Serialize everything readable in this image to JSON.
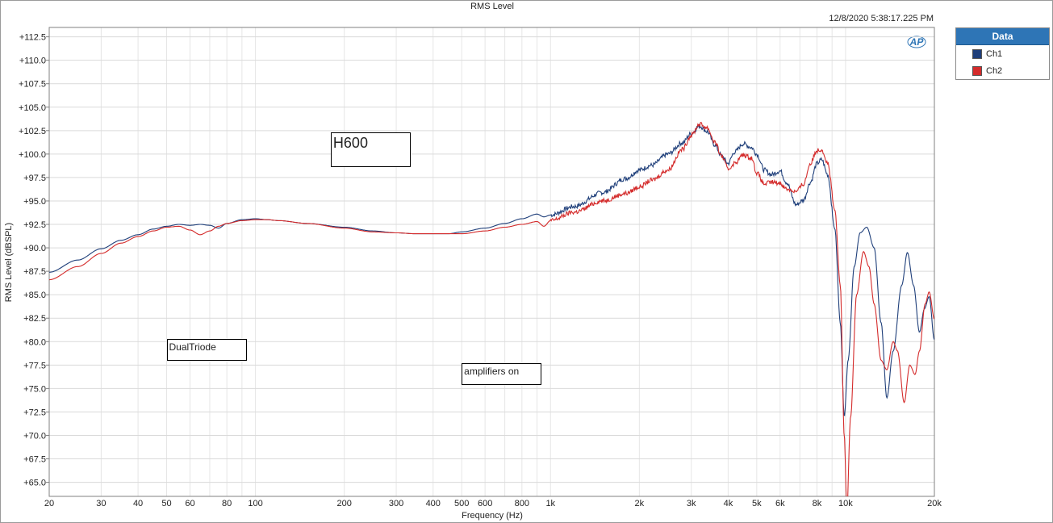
{
  "chart_data": {
    "type": "line",
    "title": "RMS Level",
    "timestamp": "12/8/2020 5:38:17.225 PM",
    "brand_mark": "AP",
    "xlabel": "Frequency (Hz)",
    "ylabel": "RMS Level (dBSPL)",
    "x_scale": "log",
    "xlim": [
      20,
      20000
    ],
    "ylim": [
      63.5,
      113.5
    ],
    "grid": true,
    "legend_title": "Data",
    "legend_placement": "right",
    "x_ticks": [
      {
        "value": 20,
        "label": "20"
      },
      {
        "value": 30,
        "label": "30"
      },
      {
        "value": 40,
        "label": "40"
      },
      {
        "value": 50,
        "label": "50"
      },
      {
        "value": 60,
        "label": "60"
      },
      {
        "value": 80,
        "label": "80"
      },
      {
        "value": 100,
        "label": "100"
      },
      {
        "value": 200,
        "label": "200"
      },
      {
        "value": 300,
        "label": "300"
      },
      {
        "value": 400,
        "label": "400"
      },
      {
        "value": 500,
        "label": "500"
      },
      {
        "value": 600,
        "label": "600"
      },
      {
        "value": 800,
        "label": "800"
      },
      {
        "value": 1000,
        "label": "1k"
      },
      {
        "value": 2000,
        "label": "2k"
      },
      {
        "value": 3000,
        "label": "3k"
      },
      {
        "value": 4000,
        "label": "4k"
      },
      {
        "value": 5000,
        "label": "5k"
      },
      {
        "value": 6000,
        "label": "6k"
      },
      {
        "value": 8000,
        "label": "8k"
      },
      {
        "value": 10000,
        "label": "10k"
      },
      {
        "value": 20000,
        "label": "20k"
      }
    ],
    "y_ticks": [
      {
        "value": 112.5,
        "label": "+112.5"
      },
      {
        "value": 110,
        "label": "+110.0"
      },
      {
        "value": 107.5,
        "label": "+107.5"
      },
      {
        "value": 105,
        "label": "+105.0"
      },
      {
        "value": 102.5,
        "label": "+102.5"
      },
      {
        "value": 100,
        "label": "+100.0"
      },
      {
        "value": 97.5,
        "label": "+97.5"
      },
      {
        "value": 95,
        "label": "+95.0"
      },
      {
        "value": 92.5,
        "label": "+92.5"
      },
      {
        "value": 90,
        "label": "+90.0"
      },
      {
        "value": 87.5,
        "label": "+87.5"
      },
      {
        "value": 85,
        "label": "+85.0"
      },
      {
        "value": 82.5,
        "label": "+82.5"
      },
      {
        "value": 80,
        "label": "+80.0"
      },
      {
        "value": 77.5,
        "label": "+77.5"
      },
      {
        "value": 75,
        "label": "+75.0"
      },
      {
        "value": 72.5,
        "label": "+72.5"
      },
      {
        "value": 70,
        "label": "+70.0"
      },
      {
        "value": 67.5,
        "label": "+67.5"
      },
      {
        "value": 65,
        "label": "+65.0"
      }
    ],
    "series": [
      {
        "name": "Ch1",
        "color": "#1f3f7a",
        "points": [
          [
            20,
            87.4
          ],
          [
            25,
            88.7
          ],
          [
            30,
            89.9
          ],
          [
            35,
            90.8
          ],
          [
            40,
            91.4
          ],
          [
            45,
            92.0
          ],
          [
            50,
            92.3
          ],
          [
            55,
            92.5
          ],
          [
            60,
            92.4
          ],
          [
            65,
            92.5
          ],
          [
            70,
            92.4
          ],
          [
            75,
            92.1
          ],
          [
            80,
            92.6
          ],
          [
            90,
            93.0
          ],
          [
            100,
            93.1
          ],
          [
            110,
            93.0
          ],
          [
            120,
            92.9
          ],
          [
            150,
            92.6
          ],
          [
            200,
            92.2
          ],
          [
            250,
            91.8
          ],
          [
            300,
            91.6
          ],
          [
            350,
            91.5
          ],
          [
            400,
            91.5
          ],
          [
            450,
            91.5
          ],
          [
            500,
            91.7
          ],
          [
            600,
            92.1
          ],
          [
            700,
            92.6
          ],
          [
            800,
            93.1
          ],
          [
            900,
            93.6
          ],
          [
            950,
            93.3
          ],
          [
            1000,
            93.5
          ],
          [
            1200,
            94.4
          ],
          [
            1500,
            95.9
          ],
          [
            1800,
            97.4
          ],
          [
            2000,
            98.3
          ],
          [
            2200,
            98.8
          ],
          [
            2500,
            100.0
          ],
          [
            2800,
            101.2
          ],
          [
            3000,
            102.2
          ],
          [
            3200,
            103.0
          ],
          [
            3400,
            102.4
          ],
          [
            3600,
            101.0
          ],
          [
            3800,
            99.8
          ],
          [
            4000,
            99.0
          ],
          [
            4200,
            100.2
          ],
          [
            4500,
            101.1
          ],
          [
            4800,
            100.7
          ],
          [
            5000,
            100.0
          ],
          [
            5300,
            98.3
          ],
          [
            5600,
            97.8
          ],
          [
            6000,
            98.2
          ],
          [
            6300,
            97.0
          ],
          [
            6800,
            94.6
          ],
          [
            7200,
            95.1
          ],
          [
            7600,
            97.0
          ],
          [
            8000,
            99.0
          ],
          [
            8300,
            99.4
          ],
          [
            8700,
            97.8
          ],
          [
            9200,
            92.0
          ],
          [
            9600,
            82.0
          ],
          [
            9900,
            72.0
          ],
          [
            10200,
            78.0
          ],
          [
            10700,
            88.0
          ],
          [
            11200,
            91.6
          ],
          [
            11800,
            92.2
          ],
          [
            12500,
            90.0
          ],
          [
            13200,
            82.0
          ],
          [
            13800,
            74.0
          ],
          [
            14500,
            79.0
          ],
          [
            15500,
            86.0
          ],
          [
            16200,
            89.5
          ],
          [
            17000,
            86.0
          ],
          [
            17800,
            81.0
          ],
          [
            18500,
            83.5
          ],
          [
            19200,
            84.8
          ],
          [
            20000,
            80.2
          ]
        ]
      },
      {
        "name": "Ch2",
        "color": "#d42b2b",
        "points": [
          [
            20,
            86.6
          ],
          [
            25,
            88.0
          ],
          [
            30,
            89.4
          ],
          [
            35,
            90.5
          ],
          [
            40,
            91.2
          ],
          [
            45,
            91.8
          ],
          [
            50,
            92.2
          ],
          [
            55,
            92.3
          ],
          [
            60,
            91.9
          ],
          [
            65,
            91.4
          ],
          [
            70,
            91.8
          ],
          [
            75,
            92.3
          ],
          [
            80,
            92.6
          ],
          [
            90,
            92.9
          ],
          [
            100,
            93.0
          ],
          [
            110,
            93.0
          ],
          [
            120,
            92.9
          ],
          [
            150,
            92.6
          ],
          [
            200,
            92.1
          ],
          [
            250,
            91.7
          ],
          [
            300,
            91.6
          ],
          [
            350,
            91.5
          ],
          [
            400,
            91.5
          ],
          [
            450,
            91.5
          ],
          [
            500,
            91.5
          ],
          [
            600,
            91.8
          ],
          [
            700,
            92.2
          ],
          [
            800,
            92.5
          ],
          [
            900,
            92.8
          ],
          [
            950,
            92.3
          ],
          [
            1000,
            92.9
          ],
          [
            1200,
            93.8
          ],
          [
            1500,
            95.0
          ],
          [
            1800,
            95.8
          ],
          [
            2000,
            96.5
          ],
          [
            2200,
            97.2
          ],
          [
            2500,
            98.3
          ],
          [
            2800,
            100.5
          ],
          [
            3000,
            102.0
          ],
          [
            3200,
            103.2
          ],
          [
            3400,
            102.8
          ],
          [
            3600,
            101.3
          ],
          [
            3800,
            99.8
          ],
          [
            4000,
            98.4
          ],
          [
            4200,
            99.0
          ],
          [
            4500,
            99.9
          ],
          [
            4800,
            99.6
          ],
          [
            5000,
            98.0
          ],
          [
            5300,
            96.8
          ],
          [
            5600,
            97.0
          ],
          [
            6000,
            96.9
          ],
          [
            6300,
            96.3
          ],
          [
            6800,
            96.0
          ],
          [
            7200,
            96.8
          ],
          [
            7600,
            99.0
          ],
          [
            8000,
            100.4
          ],
          [
            8300,
            100.5
          ],
          [
            8700,
            99.0
          ],
          [
            9200,
            94.0
          ],
          [
            9600,
            86.0
          ],
          [
            9900,
            70.0
          ],
          [
            10100,
            62.0
          ],
          [
            10400,
            72.0
          ],
          [
            10900,
            85.0
          ],
          [
            11500,
            89.6
          ],
          [
            12000,
            88.0
          ],
          [
            12500,
            84.0
          ],
          [
            13200,
            78.0
          ],
          [
            13800,
            77.0
          ],
          [
            14500,
            80.0
          ],
          [
            15000,
            79.0
          ],
          [
            15800,
            73.5
          ],
          [
            16500,
            77.5
          ],
          [
            17200,
            76.5
          ],
          [
            17800,
            79.0
          ],
          [
            18600,
            84.0
          ],
          [
            19200,
            85.3
          ],
          [
            20000,
            82.4
          ]
        ]
      }
    ],
    "annotations": [
      {
        "text": "H600",
        "x": 180,
        "y": 101.6
      },
      {
        "text": "DualTriode",
        "x": 50,
        "y": 79.6
      },
      {
        "text": "amplifiers on",
        "x": 500,
        "y": 77.0
      }
    ]
  }
}
